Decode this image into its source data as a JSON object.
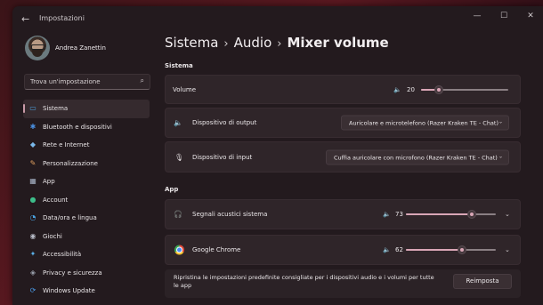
{
  "window": {
    "title": "Impostazioni",
    "back": "←",
    "minimize": "—",
    "maximize": "☐",
    "close": "✕"
  },
  "profile": {
    "name": "Andrea Zanettin"
  },
  "search": {
    "placeholder": "Trova un'impostazione",
    "icon": "⌕"
  },
  "sidebar": {
    "items": [
      {
        "label": "Sistema",
        "icon": "▭",
        "icon_color": "#4aa3e0",
        "active": true
      },
      {
        "label": "Bluetooth e dispositivi",
        "icon": "✱",
        "icon_color": "#4a8fe0"
      },
      {
        "label": "Rete e Internet",
        "icon": "◆",
        "icon_color": "#7ab8ea"
      },
      {
        "label": "Personalizzazione",
        "icon": "✎",
        "icon_color": "#e0a060"
      },
      {
        "label": "App",
        "icon": "▦",
        "icon_color": "#a8b4c8"
      },
      {
        "label": "Account",
        "icon": "●",
        "icon_color": "#3dbd8a"
      },
      {
        "label": "Data/ora e lingua",
        "icon": "◔",
        "icon_color": "#4aa3e0"
      },
      {
        "label": "Giochi",
        "icon": "◉",
        "icon_color": "#b8bcc8"
      },
      {
        "label": "Accessibilità",
        "icon": "✦",
        "icon_color": "#5ab0e8"
      },
      {
        "label": "Privacy e sicurezza",
        "icon": "◈",
        "icon_color": "#9aa0ac"
      },
      {
        "label": "Windows Update",
        "icon": "⟳",
        "icon_color": "#4a9ae8"
      }
    ]
  },
  "breadcrumb": {
    "first": "Sistema",
    "second": "Audio",
    "current": "Mixer volume",
    "separator": "›"
  },
  "system_section": {
    "label": "Sistema",
    "volume": {
      "label": "Volume",
      "value": "20",
      "percent": 20
    },
    "output": {
      "label": "Dispositivo di output",
      "value": "Auricolare e microtelefono (Razer Kraken TE - Chat)"
    },
    "input": {
      "label": "Dispositivo di input",
      "value": "Cuffia auricolare con microfono (Razer Kraken TE - Chat)"
    }
  },
  "app_section": {
    "label": "App",
    "apps": [
      {
        "name": "Segnali acustici sistema",
        "value": "73",
        "percent": 73
      },
      {
        "name": "Google Chrome",
        "value": "62",
        "percent": 62
      }
    ],
    "reset_text": "Ripristina le impostazioni predefinite consigliate per i dispositivi audio e i volumi per tutte le app",
    "reset_button": "Reimposta"
  },
  "icons": {
    "speaker": "🔈",
    "output_speaker": "🔈",
    "mic": "🎙",
    "headset": "🎧",
    "chevron_down": "⌄",
    "expand": "⌄"
  },
  "colors": {
    "accent": "#d9a6b6",
    "background": "#231a1e",
    "card": "#2f2529"
  }
}
